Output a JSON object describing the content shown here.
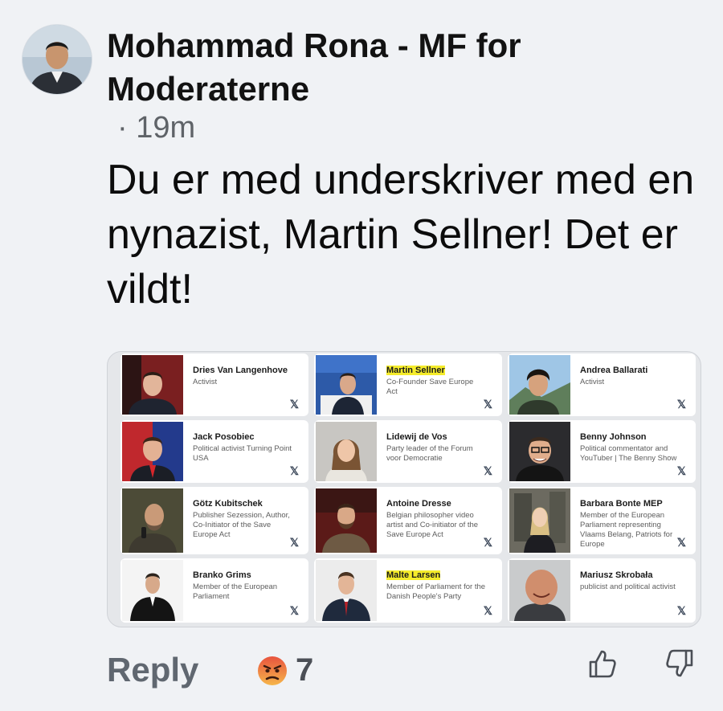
{
  "comment": {
    "author": "Mohammad Rona - MF for Moderaterne",
    "time": "· 19m",
    "text": "Du er med underskriver med en nynazist, Martin Sellner! Det er vildt!"
  },
  "attachment": {
    "cards": [
      {
        "name": "Dries Van Langenhove",
        "desc": "Activist"
      },
      {
        "name": "Martin Sellner",
        "desc": "Co-Founder Save Europe Act",
        "highlight": true
      },
      {
        "name": "Andrea Ballarati",
        "desc": "Activist"
      },
      {
        "name": "Jack Posobiec",
        "desc": "Political activist Turning Point USA"
      },
      {
        "name": "Lidewij de Vos",
        "desc": "Party leader of the Forum voor Democratie"
      },
      {
        "name": "Benny Johnson",
        "desc": "Political commentator and YouTuber | The Benny Show"
      },
      {
        "name": "Götz Kubitschek",
        "desc": "Publisher Sezession, Author, Co-Initiator of the Save Europe Act"
      },
      {
        "name": "Antoine Dresse",
        "desc": "Belgian philosopher video artist and Co-initiator of the Save Europe Act"
      },
      {
        "name": "Barbara Bonte MEP",
        "desc": "Member of the European Parliament representing Vlaams Belang, Patriots for Europe"
      },
      {
        "name": "Branko Grims",
        "desc": "Member of the European Parliament"
      },
      {
        "name": "Malte Larsen",
        "desc": "Member of Parliament for the Danish People's Party",
        "highlight": true
      },
      {
        "name": "Mariusz Skrobała",
        "desc": "publicist and political activist"
      }
    ],
    "dismiss_icon": "x-logo-icon"
  },
  "actions": {
    "reply_label": "Reply",
    "reaction_icon": "angry-face-icon",
    "reaction_count": "7",
    "upvote_icon": "thumbs-up-icon",
    "downvote_icon": "thumbs-down-icon"
  },
  "colors": {
    "background": "#f0f2f5",
    "highlight": "#f5ec2b",
    "reaction": "#e8533e"
  }
}
